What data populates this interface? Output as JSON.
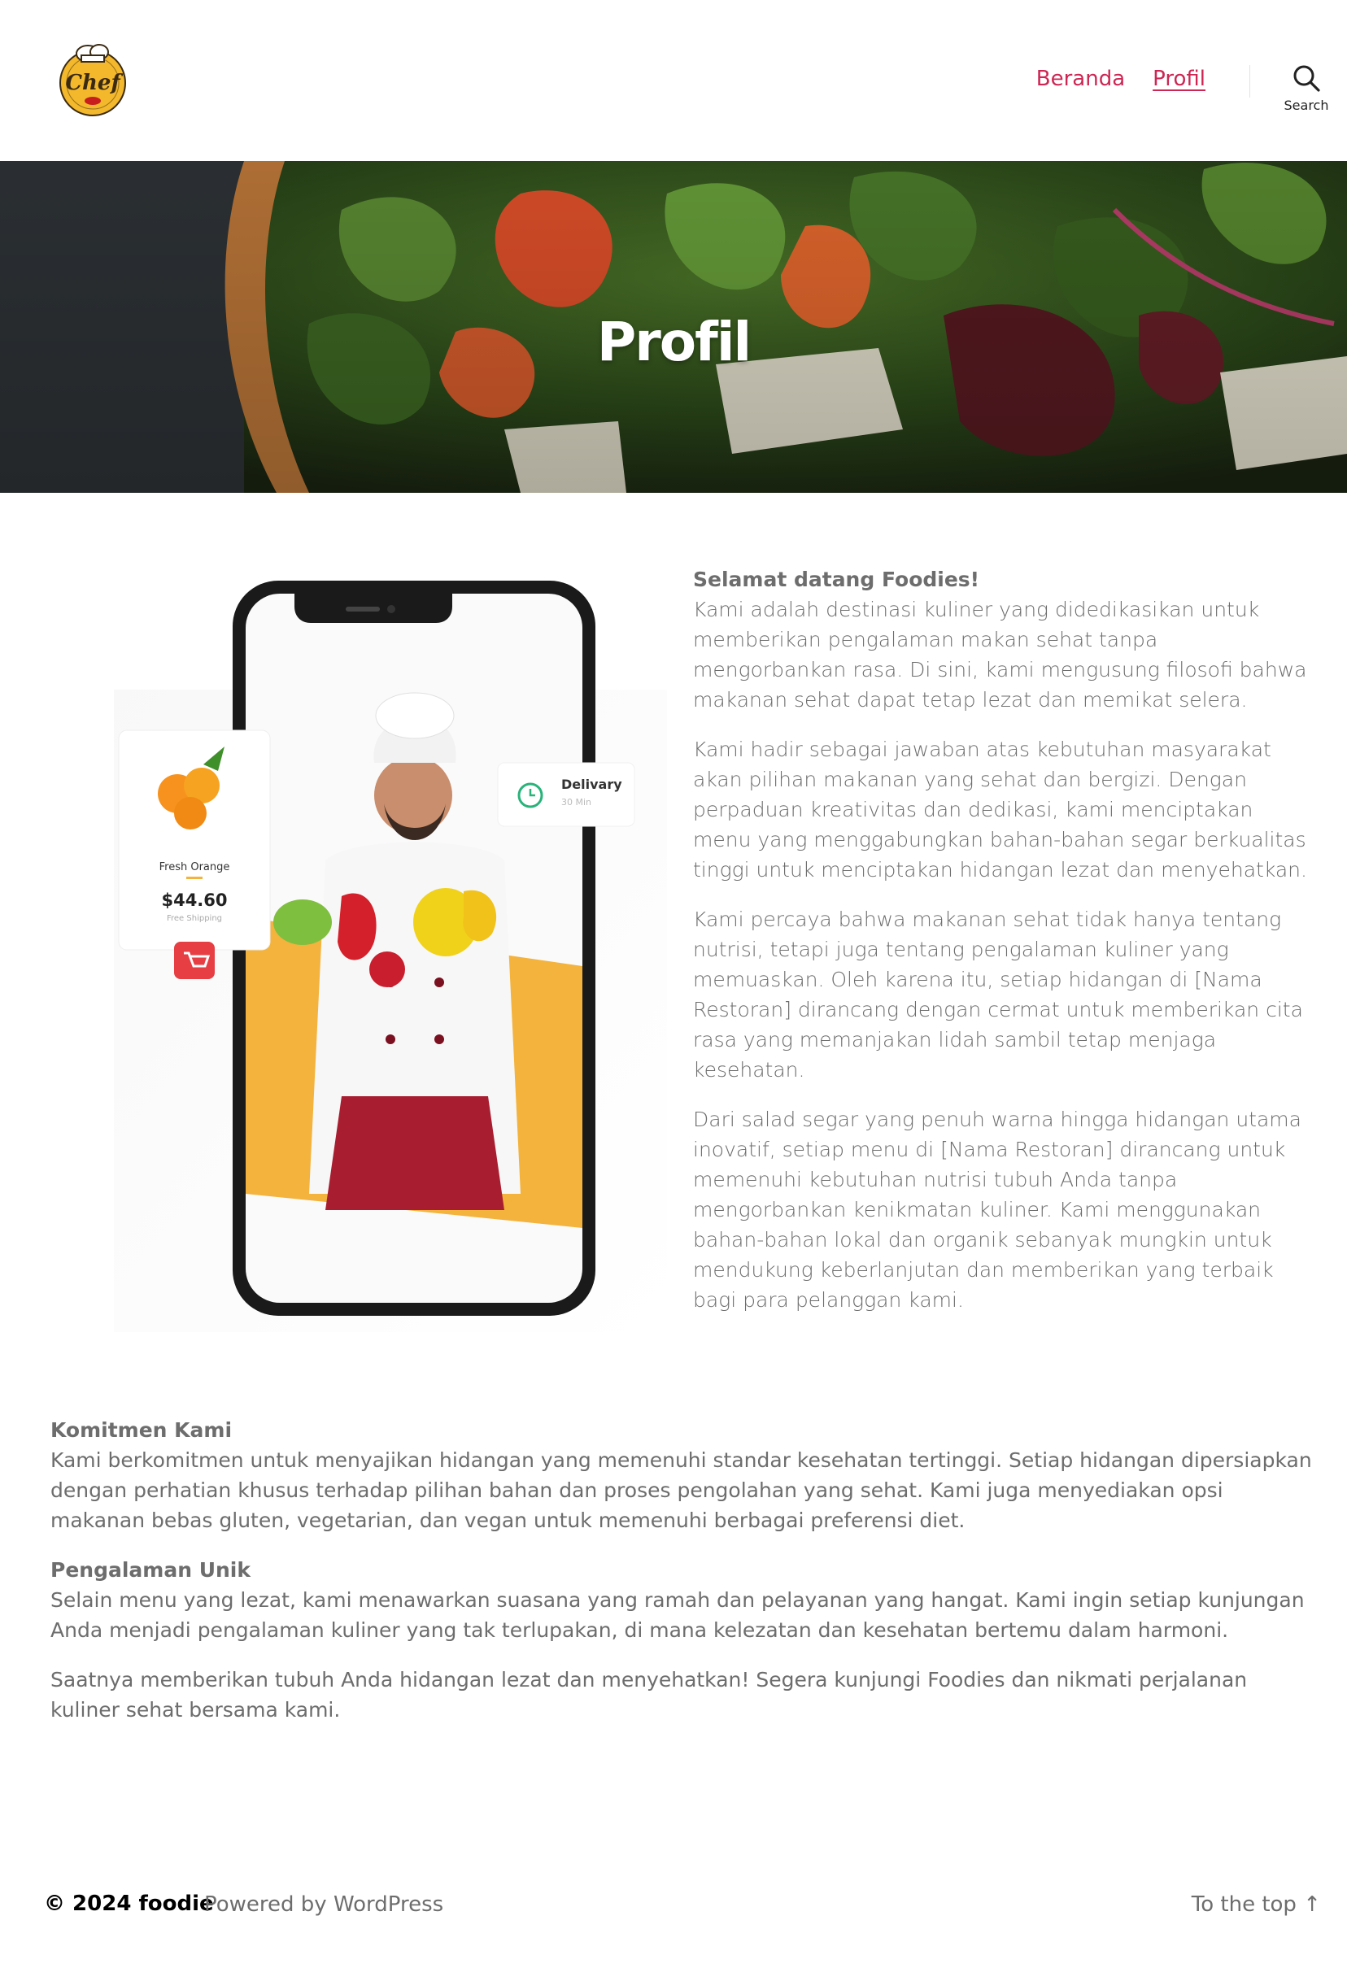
{
  "header": {
    "logo_text": "Chef",
    "nav": [
      {
        "label": "Beranda"
      },
      {
        "label": "Profil"
      }
    ],
    "search_label": "Search"
  },
  "hero": {
    "title": "Profil"
  },
  "phone_card": {
    "product_name": "Fresh Orange",
    "price": "$44.60",
    "shipping": "Free Shipping",
    "delivery_label": "Delivary",
    "delivery_time": "30 Min"
  },
  "intro": {
    "heading": "Selamat datang Foodies!",
    "p1": "Kami adalah destinasi kuliner yang didedikasikan untuk memberikan pengalaman makan sehat tanpa mengorbankan rasa. Di sini, kami mengusung filosofi bahwa makanan sehat dapat tetap lezat dan memikat selera.",
    "p2": "Kami hadir sebagai jawaban atas kebutuhan masyarakat akan pilihan makanan yang sehat dan bergizi. Dengan perpaduan kreativitas dan dedikasi, kami menciptakan menu yang menggabungkan bahan-bahan segar berkualitas tinggi untuk menciptakan hidangan lezat dan menyehatkan.",
    "p3": "Kami percaya bahwa makanan sehat tidak hanya tentang nutrisi, tetapi juga tentang pengalaman kuliner yang memuaskan. Oleh karena itu, setiap hidangan di [Nama Restoran] dirancang dengan cermat untuk memberikan cita rasa yang memanjakan lidah sambil tetap menjaga kesehatan.",
    "p4": "Dari salad segar yang penuh warna hingga hidangan utama inovatif, setiap menu di [Nama Restoran] dirancang untuk memenuhi kebutuhan nutrisi tubuh Anda tanpa mengorbankan kenikmatan kuliner. Kami menggunakan bahan-bahan lokal dan organik sebanyak mungkin untuk mendukung keberlanjutan dan memberikan yang terbaik bagi para pelanggan kami."
  },
  "lower": {
    "commit_heading": "Komitmen Kami",
    "commit_text": "Kami berkomitmen untuk menyajikan hidangan yang memenuhi standar kesehatan tertinggi. Setiap hidangan dipersiapkan dengan perhatian khusus terhadap pilihan bahan dan proses pengolahan yang sehat. Kami juga menyediakan opsi makanan bebas gluten, vegetarian, dan vegan untuk memenuhi berbagai preferensi diet.",
    "exp_heading": "Pengalaman Unik",
    "exp_text": "Selain menu yang lezat, kami menawarkan suasana yang ramah dan pelayanan yang hangat. Kami ingin setiap kunjungan Anda menjadi pengalaman kuliner yang tak terlupakan, di mana kelezatan dan kesehatan bertemu dalam harmoni.",
    "closing": "Saatnya memberikan tubuh Anda hidangan lezat dan menyehatkan! Segera kunjungi Foodies dan nikmati perjalanan kuliner sehat bersama kami."
  },
  "footer": {
    "copyright": "© 2024 foodie",
    "powered": "Powered by WordPress",
    "to_top": "To the top ↑"
  },
  "colors": {
    "accent": "#cd2653",
    "text": "#6d6d6d",
    "chef_yellow": "#f3b82b"
  }
}
